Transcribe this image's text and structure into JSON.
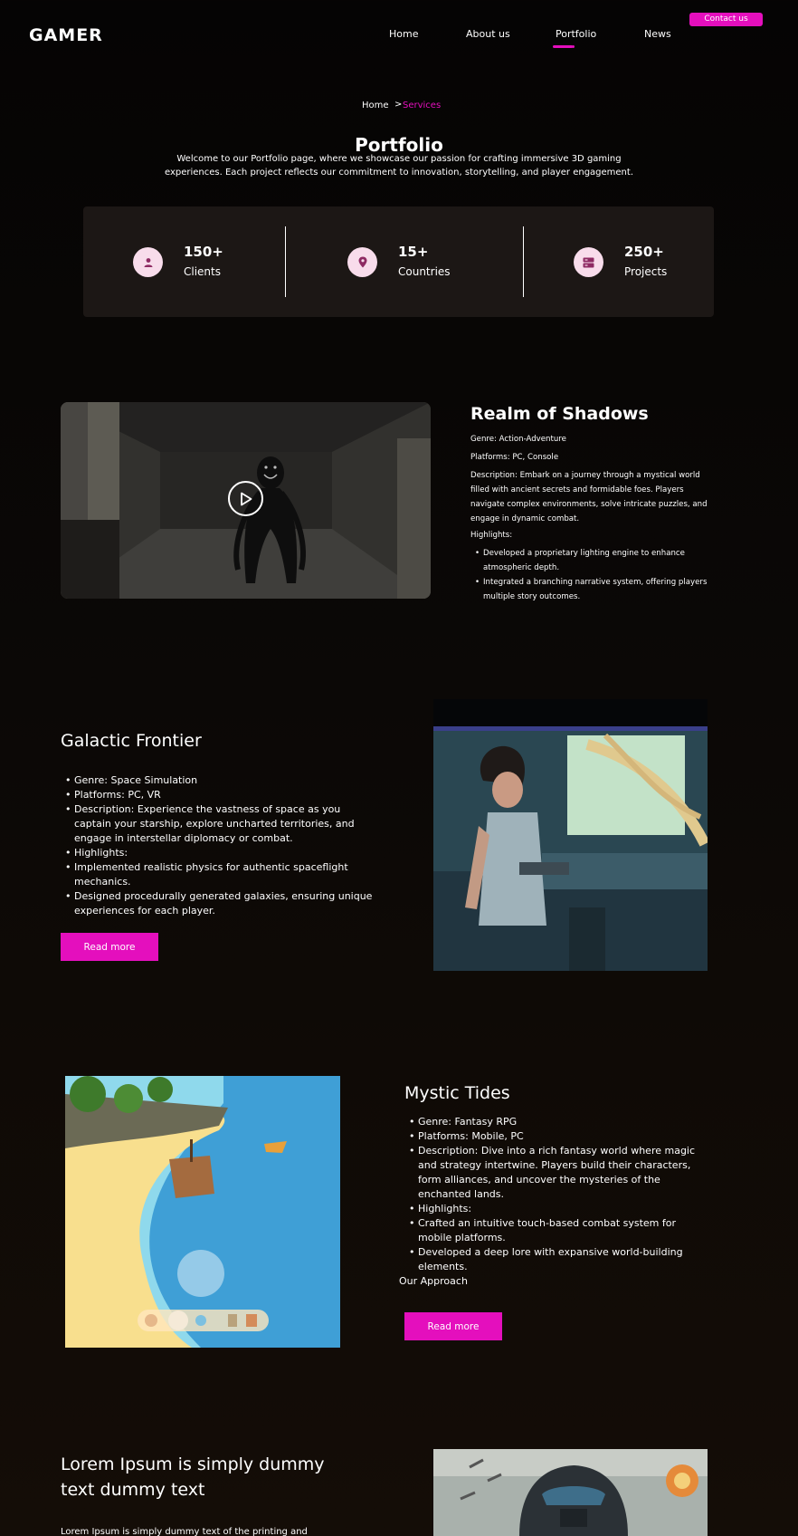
{
  "header": {
    "logo": "GAMER",
    "nav": [
      "Home",
      "About us",
      "Portfolio",
      "News"
    ],
    "active_nav": "Portfolio",
    "contact_label": "Contact us"
  },
  "breadcrumb": {
    "home": "Home",
    "separator": ">",
    "current": "Services"
  },
  "page": {
    "title": "Portfolio",
    "intro": "Welcome to our Portfolio page, where we showcase our passion for crafting immersive 3D gaming experiences. Each project reflects our commitment to innovation, storytelling, and player engagement."
  },
  "stats": [
    {
      "value": "150+",
      "label": "Clients",
      "icon": "user-icon"
    },
    {
      "value": "15+",
      "label": "Countries",
      "icon": "location-pin-icon"
    },
    {
      "value": "250+",
      "label": "Projects",
      "icon": "server-icon"
    }
  ],
  "realm": {
    "title": "Realm of Shadows",
    "genre": "Genre: Action-Adventure",
    "platforms": "Platforms: PC, Console",
    "description": "Description: Embark on a journey through a mystical world filled with ancient secrets and formidable foes. Players navigate complex environments, solve intricate puzzles, and engage in dynamic combat.",
    "highlights_label": "Highlights:",
    "highlights": [
      "Developed a proprietary lighting engine to enhance atmospheric depth.",
      "Integrated a branching narrative system, offering players multiple story outcomes."
    ]
  },
  "galactic": {
    "title": "Galactic Frontier",
    "items": [
      "Genre: Space Simulation",
      "Platforms: PC, VR",
      "Description: Experience the vastness of space as you captain your starship, explore uncharted territories, and engage in interstellar diplomacy or combat.",
      "Highlights:",
      "Implemented realistic physics for authentic spaceflight mechanics.",
      "Designed procedurally generated galaxies, ensuring unique experiences for each player."
    ],
    "button": "Read more"
  },
  "mystic": {
    "title": "Mystic Tides",
    "items": [
      "Genre: Fantasy RPG",
      "Platforms: Mobile, PC",
      "Description: Dive into a rich fantasy world where magic and strategy intertwine. Players build their characters, form alliances, and uncover the mysteries of the enchanted lands.",
      "Highlights:",
      "Crafted an intuitive touch-based combat system for mobile platforms.",
      "Developed a deep lore with expansive world-building elements."
    ],
    "approach": "Our Approach",
    "button": "Read more"
  },
  "lorem": {
    "title": "Lorem Ipsum is simply dummy text dummy text",
    "body": "Lorem Ipsum is simply dummy text of the printing and"
  },
  "colors": {
    "accent": "#e40fbd",
    "card": "#1c1715",
    "icon_bg": "#f8dceb"
  }
}
